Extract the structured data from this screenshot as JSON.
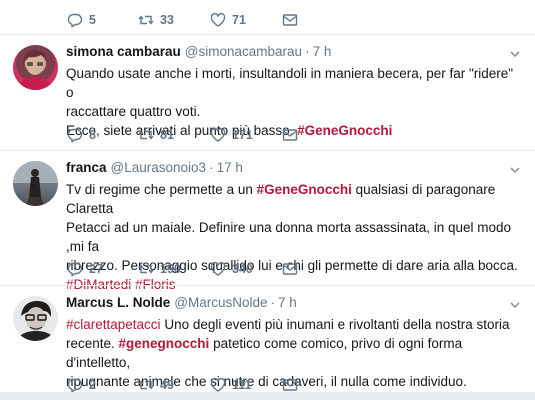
{
  "top_tweet": {
    "replies": "5",
    "retweets": "33",
    "likes": "71"
  },
  "tweets": [
    {
      "name": "simona cambarau",
      "handle": "@simonacambarau",
      "time": "7 h",
      "line1": "Quando usate anche i morti, insultandoli in maniera becera, per far \"ridere\" o",
      "line2": "raccattare quattro voti.",
      "line3": "Ecco, siete arrivati al punto più basso. ",
      "hashtag": "#GeneGnocchi",
      "replies": "8",
      "retweets": "81",
      "likes": "171"
    },
    {
      "name": "franca",
      "handle": "@Laurasonoio3",
      "time": "17 h",
      "line1_pre": "Tv di regime che permette a un ",
      "line1_hashtag": "#GeneGnocchi",
      "line1_post": " qualsiasi di paragonare Claretta",
      "line2": "Petacci ad un maiale. Definire una donna morta assassinata, in quel modo ,mi fa",
      "line3": "ribrezzo. Personaggio squallido lui e chi gli permette di dare aria alla bocca.",
      "hashtag_a": "#DiMartedi",
      "hashtag_b": "#Floris",
      "replies": "27",
      "retweets": "190",
      "likes": "340"
    },
    {
      "name": "Marcus L. Nolde",
      "handle": "@MarcusNolde",
      "time": "7 h",
      "line1_hashtag": "#clarettapetacci",
      "line1_post": " Uno degli eventi più inumani e rivoltanti della nostra storia",
      "line2": "recente. ",
      "line2_hashtag": "#genegnocchi",
      "line2_post": " patetico come comico, privo di ogni forma d'intelletto,",
      "line3": "ripugnante animale che si nutre di cadaveri, il nulla come individuo.",
      "replies": "2",
      "retweets": "49",
      "likes": "111"
    }
  ],
  "icons": [
    "reply-icon",
    "retweet-icon",
    "like-icon",
    "message-icon",
    "caret-down-icon"
  ],
  "colors": {
    "hashtag": "#b3183a",
    "meta": "#657786",
    "divider": "#e6ecf0"
  }
}
